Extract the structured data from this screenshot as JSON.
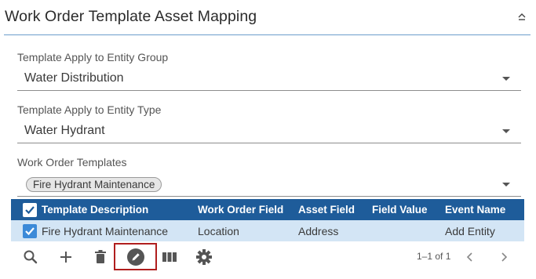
{
  "panel": {
    "title": "Work Order Template Asset Mapping",
    "collapse_icon": "chevron-up-icon"
  },
  "fields": [
    {
      "label": "Template Apply to Entity Group",
      "value": "Water Distribution"
    },
    {
      "label": "Template Apply to Entity Type",
      "value": "Water Hydrant"
    },
    {
      "label": "Work Order Templates",
      "chips": [
        "Fire Hydrant Maintenance"
      ]
    }
  ],
  "table": {
    "columns": [
      "Template Description",
      "Work Order Field",
      "Asset Field",
      "Field Value",
      "Event Name"
    ],
    "rows": [
      {
        "checked": true,
        "cells": [
          "Fire Hydrant Maintenance",
          "Location",
          "Address",
          "",
          "Add Entity"
        ]
      }
    ],
    "header_checked": true
  },
  "toolbar": {
    "buttons": [
      "search-icon",
      "add-icon",
      "delete-icon",
      "edit-icon",
      "columns-icon",
      "settings-icon"
    ],
    "highlighted": "edit-icon",
    "pager": "1–1 of 1"
  },
  "colors": {
    "header_bg": "#1e5c9a",
    "row_bg": "#d3e5f5",
    "checkbox": "#3c8ad8",
    "divider": "#6b9ecb",
    "highlight_border": "#b01e1e"
  }
}
